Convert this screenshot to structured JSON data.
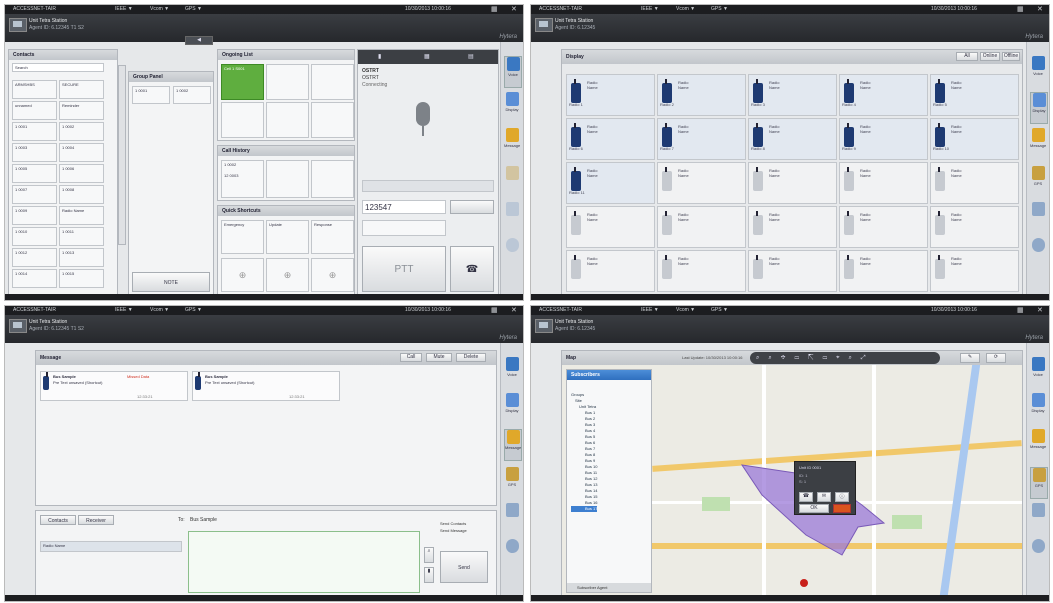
{
  "q1": {
    "titlebar": {
      "app": "ACCESSNET-TAIR",
      "items": [
        "IEEE ▼",
        "Vcom ▼",
        "GPS ▼"
      ],
      "time": "10/30/2013 10:00:16"
    },
    "header": {
      "line1": "Unit Tetra Station",
      "line2": "Agent ID: 6.12345 T1 S2"
    },
    "logo": "Hytera",
    "contacts": {
      "title": "Contacts",
      "search": "Search",
      "rows": [
        [
          "ARMSHBS",
          "SECURE"
        ],
        [
          "unnamed",
          "Reminder"
        ],
        [
          "1 0001",
          "1 0002"
        ],
        [
          "1 0003",
          "1 0004"
        ],
        [
          "1 0005",
          "1 0006"
        ],
        [
          "1 0007",
          "1 0008"
        ],
        [
          "1 0009",
          "Radio Name"
        ],
        [
          "1 0010",
          "1 0011"
        ],
        [
          "1 0012",
          "1 0013"
        ],
        [
          "1 0014",
          "1 0015"
        ]
      ]
    },
    "group_panel": {
      "title": "Group Panel",
      "cells": [
        "1 0001",
        "1 0002"
      ],
      "footer": "NOTE"
    },
    "ongoing": {
      "title": "Ongoing List",
      "active": "Cell 1 S001"
    },
    "call_history": {
      "title": "Call History",
      "item1": "1 0002",
      "item2": "12 0003"
    },
    "quick_shortcuts": {
      "title": "Quick Shortcuts",
      "items": [
        "Emergency",
        "Update",
        "Response"
      ]
    },
    "call_panel": {
      "id": "OSTRT",
      "line2": "OSTRT",
      "line3": "Connecting",
      "number": "123547",
      "ptt": "PTT"
    }
  },
  "q2": {
    "titlebar": {
      "app": "ACCESSNET-TAIR",
      "items": [
        "IEEE ▼",
        "Vcom ▼",
        "GPS ▼"
      ],
      "time": "10/30/2013 10:00:16"
    },
    "header": {
      "line1": "Unit Tetra Station",
      "line2": "Agent ID: 6.12345"
    },
    "logo": "Hytera",
    "panel": {
      "title": "Display",
      "buttons": [
        "All",
        "Online",
        "Offline"
      ]
    },
    "grid": [
      {
        "label": "Radio Name",
        "name": "Radio 1",
        "active": true
      },
      {
        "label": "Radio Name",
        "name": "Radio 2",
        "active": true
      },
      {
        "label": "Radio Name",
        "name": "Radio 3",
        "active": true
      },
      {
        "label": "Radio Name",
        "name": "Radio 4",
        "active": true
      },
      {
        "label": "Radio Name",
        "name": "Radio 5",
        "active": true
      },
      {
        "label": "Radio Name",
        "name": "Radio 6",
        "active": true
      },
      {
        "label": "Radio Name",
        "name": "Radio 7",
        "active": true
      },
      {
        "label": "Radio Name",
        "name": "Radio 8",
        "active": true
      },
      {
        "label": "Radio Name",
        "name": "Radio 9",
        "active": true
      },
      {
        "label": "Radio Name",
        "name": "Radio 10",
        "active": true
      },
      {
        "label": "Radio Name",
        "name": "Radio 11",
        "active": true
      },
      {
        "label": "Radio Name",
        "name": "",
        "active": false
      },
      {
        "label": "Radio Name",
        "name": "",
        "active": false
      },
      {
        "label": "Radio Name",
        "name": "",
        "active": false
      },
      {
        "label": "Radio Name",
        "name": "",
        "active": false
      },
      {
        "label": "Radio Name",
        "name": "",
        "active": false
      },
      {
        "label": "Radio Name",
        "name": "",
        "active": false
      },
      {
        "label": "Radio Name",
        "name": "",
        "active": false
      },
      {
        "label": "Radio Name",
        "name": "",
        "active": false
      },
      {
        "label": "Radio Name",
        "name": "",
        "active": false
      },
      {
        "label": "Radio Name",
        "name": "",
        "active": false
      },
      {
        "label": "Radio Name",
        "name": "",
        "active": false
      },
      {
        "label": "Radio Name",
        "name": "",
        "active": false
      },
      {
        "label": "Radio Name",
        "name": "",
        "active": false
      },
      {
        "label": "Radio Name",
        "name": "",
        "active": false
      }
    ]
  },
  "q3": {
    "titlebar": {
      "app": "ACCESSNET-TAIR",
      "items": [
        "IEEE ▼",
        "Vcom ▼",
        "GPS ▼"
      ],
      "time": "10/30/2013 10:00:16"
    },
    "header": {
      "line1": "Unit Tetra Station",
      "line2": "Agent ID: 6.12345 T1 S2"
    },
    "logo": "Hytera",
    "panel": {
      "title": "Message",
      "buttons": [
        "Call",
        "Mute",
        "Delete"
      ]
    },
    "messages": [
      {
        "from": "Bus Sample",
        "body": "Pre Text unsaved (Shortcut)",
        "tag": "Missed Data",
        "time": "12:33:21"
      },
      {
        "from": "Bus Sample",
        "body": "Pre Text unsaved (Shortcut)",
        "time": "12:33:21"
      }
    ],
    "tabs": [
      "Contacts",
      "Receiver"
    ],
    "to_label": "To:",
    "to_value": "Bus Sample",
    "contact": "Radio Name",
    "options": [
      "Send Contacts",
      "Send Message"
    ],
    "send": "Send"
  },
  "q4": {
    "titlebar": {
      "app": "ACCESSNET-TAIR",
      "items": [
        "IEEE ▼",
        "Vcom ▼",
        "GPS ▼"
      ],
      "time": "10/30/2013 10:00:16"
    },
    "header": {
      "line1": "Unit Tetra Station",
      "line2": "Agent ID: 6.12345"
    },
    "logo": "Hytera",
    "map": {
      "title": "Map",
      "last_update": "Last Update: 10/30/2013 10:00:16"
    },
    "tree": {
      "title": "Subscribers",
      "items": [
        "Groups",
        "Site",
        "Unit Tetra",
        "Bus 1",
        "Bus 2",
        "Bus 3",
        "Bus 4",
        "Bus 5",
        "Bus 6",
        "Bus 7",
        "Bus 8",
        "Bus 9",
        "Bus 10",
        "Bus 11",
        "Bus 12",
        "Bus 13",
        "Bus 14",
        "Bus 15",
        "Bus 16",
        "Bus 17"
      ],
      "footer": "Subscriber Agent"
    },
    "popup": {
      "title": "Unit ID 0001",
      "lines": [
        "ID: 1",
        "S: 1"
      ],
      "btn": "OK"
    }
  },
  "nav": [
    "Voice",
    "Display",
    "Message",
    "GPS",
    "Map",
    "Settings"
  ],
  "colors": {
    "titlebar": "#1c1d20",
    "header": "#2f3236",
    "accent_green": "#5fae3f",
    "radio_blue": "#1e3a72",
    "map_polygon": "#9b7ad8",
    "road": "#f1c86a"
  }
}
